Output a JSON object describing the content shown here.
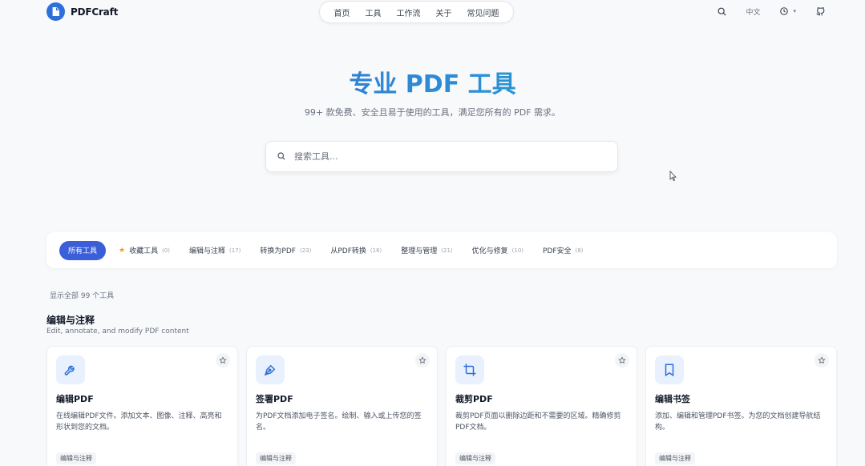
{
  "brand": {
    "name": "PDFCraft"
  },
  "nav": {
    "items": [
      "首页",
      "工具",
      "工作流",
      "关于",
      "常见问题"
    ]
  },
  "header": {
    "language": "中文"
  },
  "hero": {
    "title": "专业 PDF 工具",
    "subtitle": "99+ 款免费、安全且易于使用的工具，满足您所有的 PDF 需求。"
  },
  "search": {
    "placeholder": "搜索工具..."
  },
  "categories": [
    {
      "label": "所有工具",
      "count": ""
    },
    {
      "label": "收藏工具",
      "count": "(0)"
    },
    {
      "label": "编辑与注释",
      "count": "(17)"
    },
    {
      "label": "转换为PDF",
      "count": "(23)"
    },
    {
      "label": "从PDF转换",
      "count": "(16)"
    },
    {
      "label": "整理与管理",
      "count": "(21)"
    },
    {
      "label": "优化与修复",
      "count": "(10)"
    },
    {
      "label": "PDF安全",
      "count": "(8)"
    }
  ],
  "showing": "显示全部 99 个工具",
  "section": {
    "title": "编辑与注释",
    "description": "Edit, annotate, and modify PDF content"
  },
  "cards": [
    {
      "icon": "wrench-icon",
      "title": "编辑PDF",
      "desc": "在线编辑PDF文件。添加文本、图像、注释、高亮和形状到您的文档。",
      "tag": "编辑与注释"
    },
    {
      "icon": "pen-nib-icon",
      "title": "签署PDF",
      "desc": "为PDF文档添加电子签名。绘制、输入或上传您的签名。",
      "tag": "编辑与注释"
    },
    {
      "icon": "crop-icon",
      "title": "裁剪PDF",
      "desc": "裁剪PDF页面以删除边距和不需要的区域。精确修剪PDF文档。",
      "tag": "编辑与注释"
    },
    {
      "icon": "bookmark-icon",
      "title": "编辑书签",
      "desc": "添加、编辑和管理PDF书签。为您的文档创建导航结构。",
      "tag": "编辑与注释"
    }
  ],
  "colors": {
    "accent": "#3b5fd8",
    "icon_bg": "#e8f1fd"
  }
}
